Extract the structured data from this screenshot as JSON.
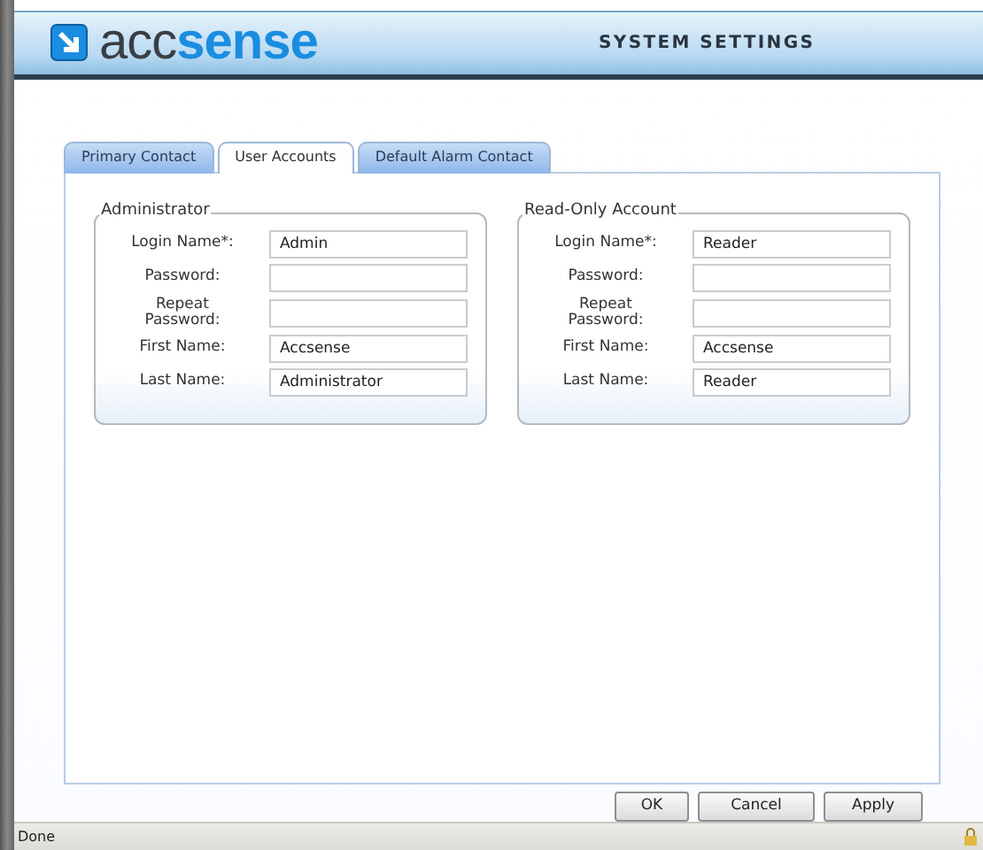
{
  "header": {
    "logo_prefix": "acc",
    "logo_accent": "sense",
    "title": "SYSTEM SETTINGS"
  },
  "tabs": [
    {
      "label": "Primary Contact",
      "selected": false
    },
    {
      "label": "User Accounts",
      "selected": true
    },
    {
      "label": "Default Alarm Contact",
      "selected": false
    }
  ],
  "accounts": [
    {
      "legend": "Administrator",
      "fields": [
        {
          "label": "Login Name*:",
          "value": "Admin"
        },
        {
          "label": "Password:"
        },
        {
          "label": "Repeat Password:"
        },
        {
          "label": "First Name:",
          "value": "Accsense"
        },
        {
          "label": "Last Name:",
          "value": "Administrator"
        }
      ]
    },
    {
      "legend": "Read-Only Account",
      "fields": [
        {
          "label": "Login Name*:",
          "value": "Reader"
        },
        {
          "label": "Password:"
        },
        {
          "label": "Repeat Password:"
        },
        {
          "label": "First Name:",
          "value": "Accsense"
        },
        {
          "label": "Last Name:",
          "value": "Reader"
        }
      ]
    }
  ],
  "buttons": [
    "OK",
    "Cancel",
    "Apply"
  ],
  "status_bar": {
    "text": "Done"
  }
}
